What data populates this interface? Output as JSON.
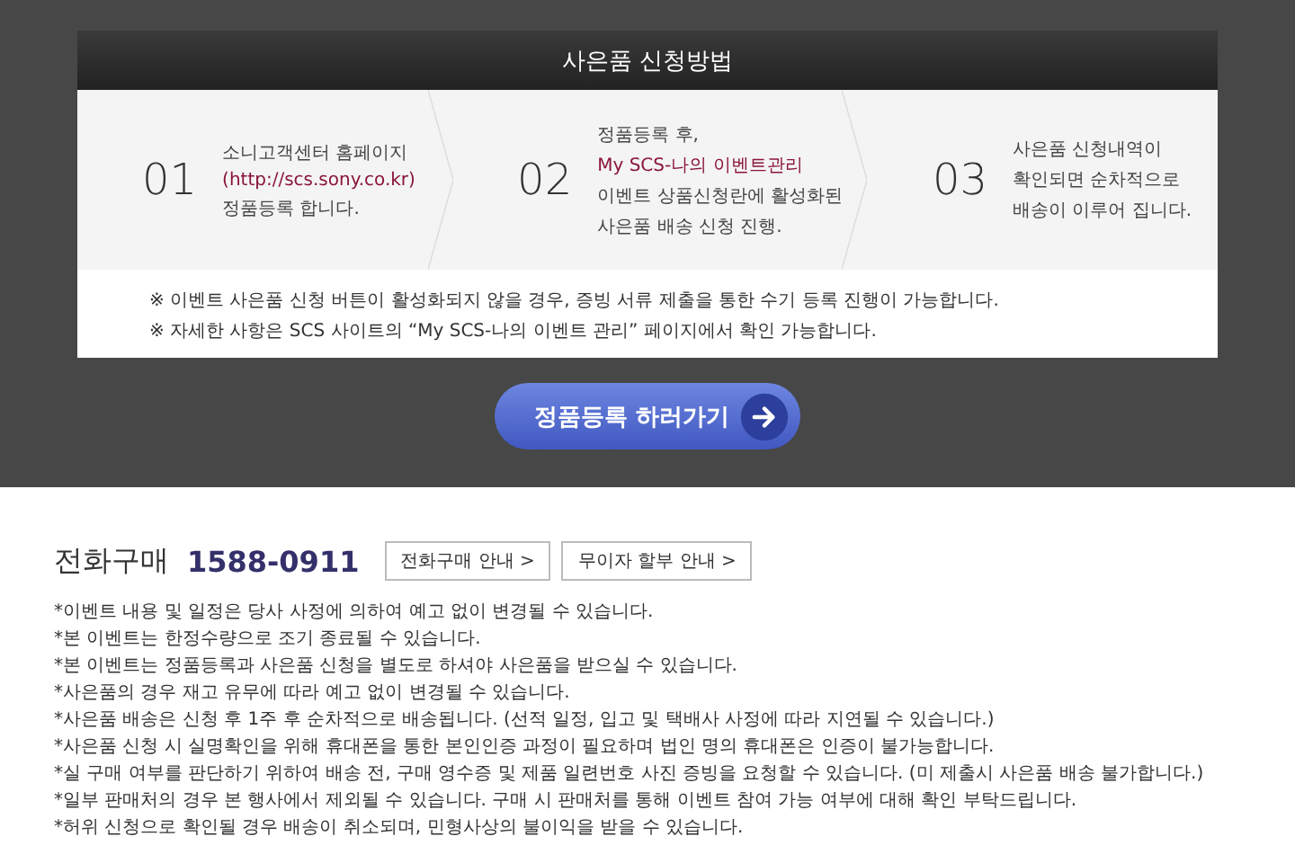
{
  "panel": {
    "title": "사은품 신청방법",
    "steps": [
      {
        "number": "01",
        "lines": [
          {
            "text": "소니고객센터 홈페이지",
            "accent": false
          },
          {
            "text": "(http://scs.sony.co.kr)",
            "accent": true
          },
          {
            "text": "정품등록 합니다.",
            "accent": false
          }
        ]
      },
      {
        "number": "02",
        "lines": [
          {
            "text": "정품등록 후,",
            "accent": false
          },
          {
            "text": "My SCS-나의 이벤트관리",
            "accent": true
          },
          {
            "text": "이벤트 상품신청란에 활성화된",
            "accent": false
          },
          {
            "text": "사은품 배송 신청 진행.",
            "accent": false
          }
        ]
      },
      {
        "number": "03",
        "lines": [
          {
            "text": "사은품 신청내역이",
            "accent": false
          },
          {
            "text": "확인되면 순차적으로",
            "accent": false
          },
          {
            "text": "배송이 이루어 집니다.",
            "accent": false
          }
        ]
      }
    ],
    "notes": [
      "※ 이벤트 사은품 신청 버튼이 활성화되지 않을 경우, 증빙 서류 제출을 통한 수기 등록 진행이 가능합니다.",
      "※ 자세한 사항은 SCS 사이트의 “My SCS-나의 이벤트 관리” 페이지에서 확인 가능합니다."
    ]
  },
  "cta": {
    "label": "정품등록 하러가기"
  },
  "phone": {
    "label": "전화구매",
    "number": "1588-0911",
    "buttons": [
      "전화구매 안내 >",
      "무이자 할부 안내 >"
    ]
  },
  "notices": [
    "*이벤트 내용 및 일정은 당사 사정에 의하여 예고 없이 변경될 수 있습니다.",
    "*본 이벤트는 한정수량으로 조기 종료될 수 있습니다.",
    "*본 이벤트는 정품등록과 사은품 신청을 별도로 하셔야 사은품을 받으실 수 있습니다.",
    "*사은품의 경우 재고 유무에 따라 예고 없이 변경될 수 있습니다.",
    "*사은품 배송은 신청 후 1주 후 순차적으로 배송됩니다. (선적 일정, 입고 및 택배사 사정에 따라 지연될 수 있습니다.)",
    "*사은품 신청 시 실명확인을 위해 휴대폰을 통한 본인인증 과정이 필요하며 법인 명의 휴대폰은 인증이 불가능합니다.",
    "*실 구매 여부를 판단하기 위하여 배송 전, 구매 영수증 및 제품 일련번호 사진 증빙을 요청할 수 있습니다. (미 제출시 사은품 배송 불가합니다.)",
    "*일부 판매처의 경우 본 행사에서 제외될 수 있습니다. 구매 시 판매처를 통해 이벤트 참여 가능 여부에 대해 확인 부탁드립니다.",
    "*허위 신청으로 확인될 경우 배송이 취소되며, 민형사상의 불이익을 받을 수 있습니다."
  ]
}
